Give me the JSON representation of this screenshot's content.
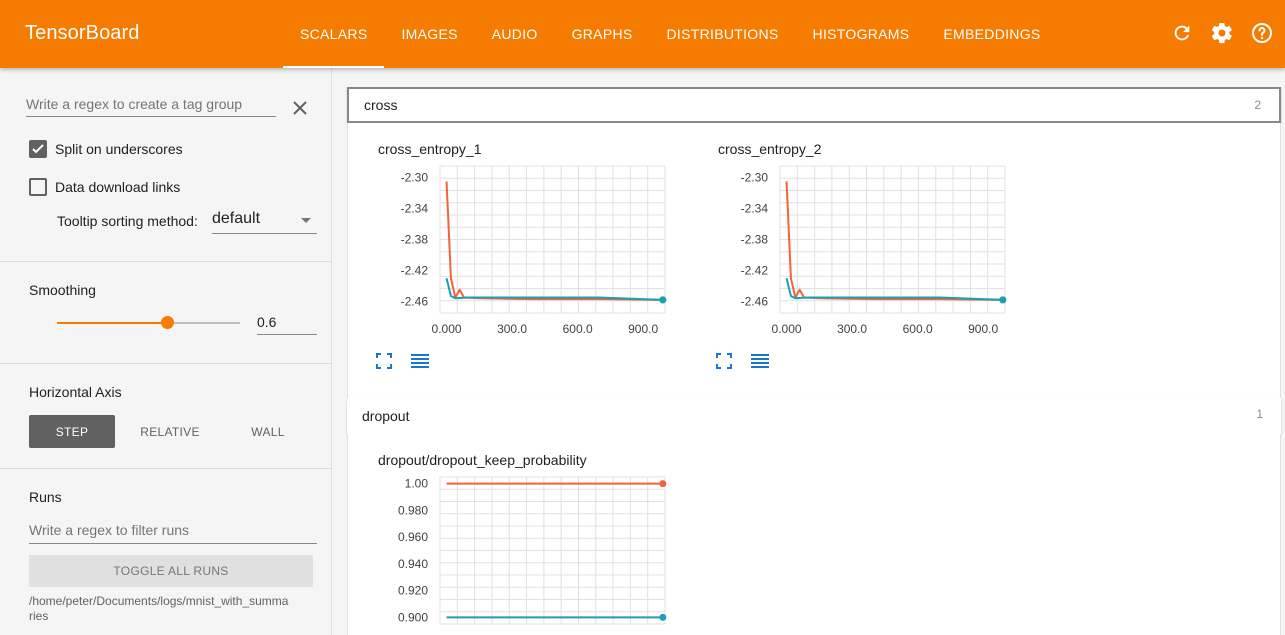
{
  "app": {
    "title": "TensorBoard",
    "tabs": [
      {
        "label": "SCALARS",
        "active": true
      },
      {
        "label": "IMAGES"
      },
      {
        "label": "AUDIO"
      },
      {
        "label": "GRAPHS"
      },
      {
        "label": "DISTRIBUTIONS"
      },
      {
        "label": "HISTOGRAMS"
      },
      {
        "label": "EMBEDDINGS"
      }
    ],
    "icons": [
      "refresh-icon",
      "settings-icon",
      "help-icon"
    ],
    "accent": "#f57c00"
  },
  "sidebar": {
    "tag_regex_placeholder": "Write a regex to create a tag group",
    "split_underscores": {
      "label": "Split on underscores",
      "checked": true
    },
    "data_download": {
      "label": "Data download links",
      "checked": false
    },
    "tooltip_sort": {
      "label": "Tooltip sorting method:",
      "value": "default"
    },
    "smoothing": {
      "title": "Smoothing",
      "value": "0.6",
      "fraction": 0.6
    },
    "horizontal_axis": {
      "title": "Horizontal Axis",
      "options": [
        "STEP",
        "RELATIVE",
        "WALL"
      ],
      "selected": "STEP"
    },
    "runs": {
      "title": "Runs",
      "filter_placeholder": "Write a regex to filter runs",
      "toggle_label": "TOGGLE ALL RUNS",
      "path": "/home/peter/Documents/logs/mnist_with_summaries"
    }
  },
  "categories": [
    {
      "name": "cross",
      "count": "2"
    },
    {
      "name": "dropout",
      "count": "1"
    }
  ],
  "chart_data": [
    {
      "type": "line",
      "title": "cross_entropy_1",
      "xlabel": "",
      "ylabel": "",
      "xlim": [
        -30,
        1000
      ],
      "ylim": [
        -2.475,
        -2.285
      ],
      "x_ticks": [
        "0.000",
        "300.0",
        "600.0",
        "900.0"
      ],
      "y_ticks": [
        "-2.30",
        "-2.34",
        "-2.38",
        "-2.42",
        "-2.46"
      ],
      "series": [
        {
          "color": "#f4623a",
          "x": [
            0,
            20,
            40,
            60,
            80,
            150,
            400,
            700,
            990
          ],
          "y": [
            -2.305,
            -2.43,
            -2.455,
            -2.445,
            -2.455,
            -2.456,
            -2.457,
            -2.457,
            -2.458
          ]
        },
        {
          "color": "#1a9fb5",
          "x": [
            0,
            20,
            40,
            100,
            400,
            700,
            990
          ],
          "y": [
            -2.43,
            -2.453,
            -2.456,
            -2.455,
            -2.455,
            -2.455,
            -2.458
          ]
        }
      ],
      "grid": true
    },
    {
      "type": "line",
      "title": "cross_entropy_2",
      "xlabel": "",
      "ylabel": "",
      "xlim": [
        -30,
        1000
      ],
      "ylim": [
        -2.475,
        -2.285
      ],
      "x_ticks": [
        "0.000",
        "300.0",
        "600.0",
        "900.0"
      ],
      "y_ticks": [
        "-2.30",
        "-2.34",
        "-2.38",
        "-2.42",
        "-2.46"
      ],
      "series": [
        {
          "color": "#f4623a",
          "x": [
            0,
            20,
            40,
            60,
            80,
            150,
            400,
            700,
            990
          ],
          "y": [
            -2.305,
            -2.43,
            -2.455,
            -2.445,
            -2.455,
            -2.456,
            -2.457,
            -2.457,
            -2.458
          ]
        },
        {
          "color": "#1a9fb5",
          "x": [
            0,
            20,
            40,
            100,
            400,
            700,
            990
          ],
          "y": [
            -2.43,
            -2.453,
            -2.456,
            -2.455,
            -2.455,
            -2.455,
            -2.458
          ]
        }
      ],
      "grid": true
    },
    {
      "type": "line",
      "title": "dropout/dropout_keep_probability",
      "xlabel": "",
      "ylabel": "",
      "xlim": [
        -30,
        1000
      ],
      "ylim": [
        0.895,
        1.005
      ],
      "x_ticks": [],
      "y_ticks": [
        "1.00",
        "0.980",
        "0.960",
        "0.940",
        "0.920",
        "0.900"
      ],
      "series": [
        {
          "color": "#f4623a",
          "x": [
            0,
            990
          ],
          "y": [
            1.0,
            1.0
          ]
        },
        {
          "color": "#1a9fb5",
          "x": [
            0,
            990
          ],
          "y": [
            0.9,
            0.9
          ]
        }
      ],
      "grid": true
    }
  ]
}
